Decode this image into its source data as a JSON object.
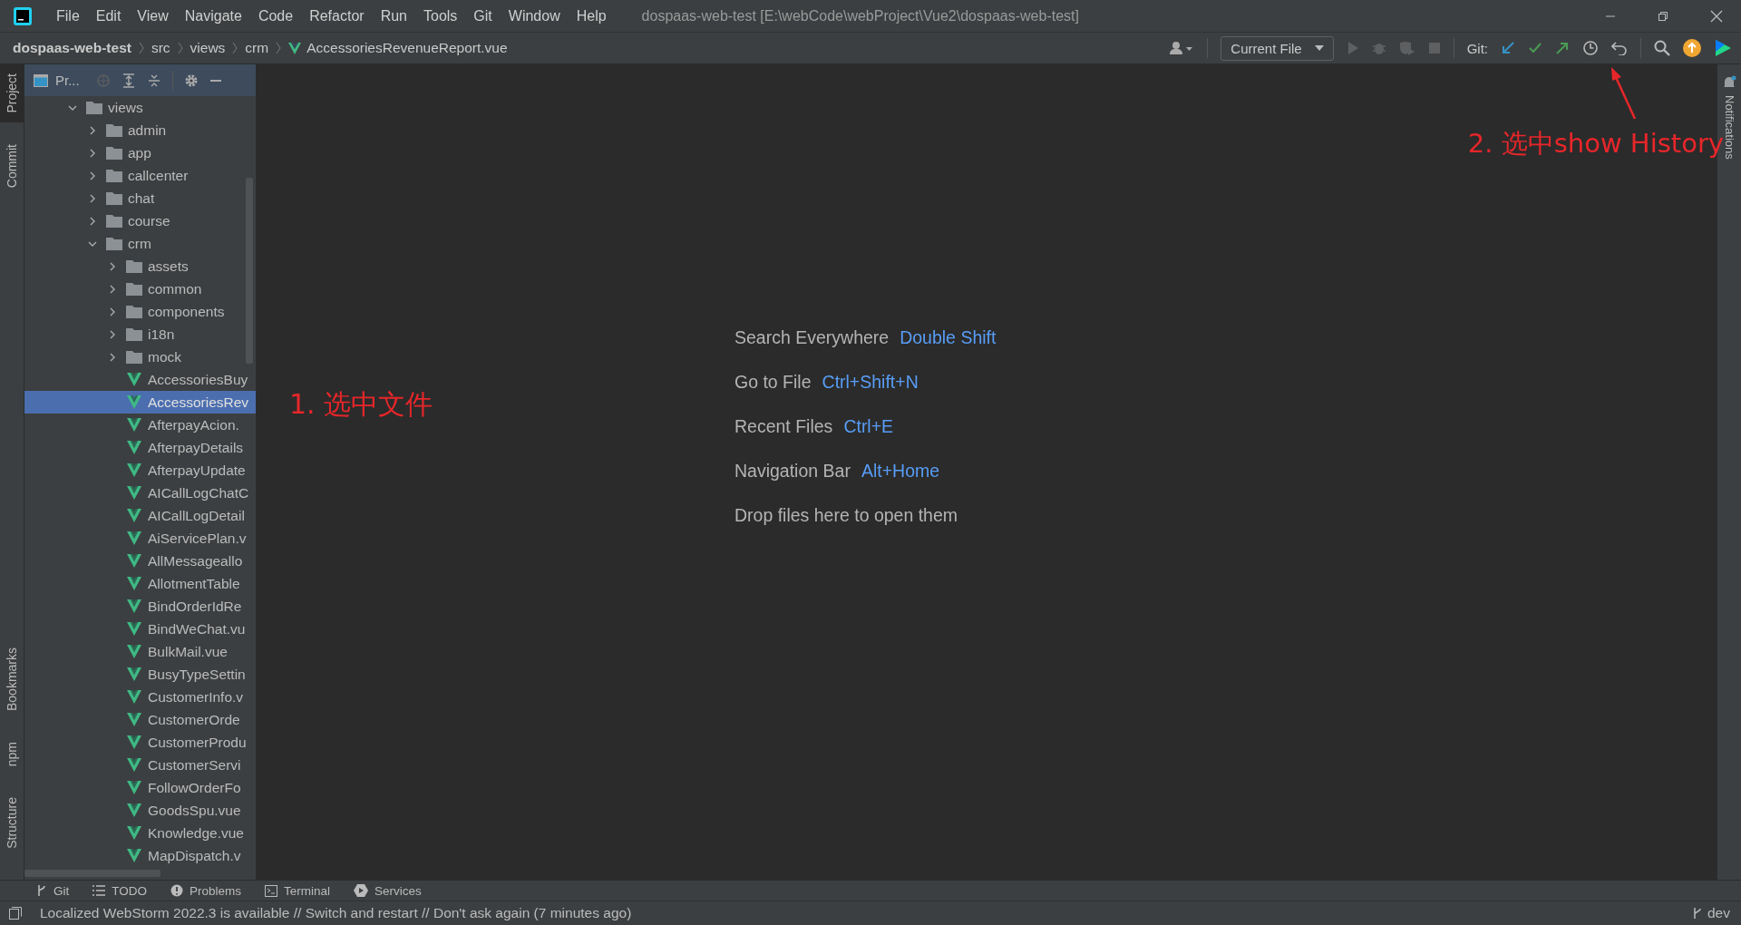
{
  "menu": [
    "File",
    "Edit",
    "View",
    "Navigate",
    "Code",
    "Refactor",
    "Run",
    "Tools",
    "Git",
    "Window",
    "Help"
  ],
  "window": {
    "title": "dospaas-web-test [E:\\webCode\\webProject\\Vue2\\dospaas-web-test]"
  },
  "breadcrumb": [
    "dospaas-web-test",
    "src",
    "views",
    "crm"
  ],
  "breadcrumb_file": "AccessoriesRevenueReport.vue",
  "toolbar": {
    "run_config": "Current File",
    "git_label": "Git:"
  },
  "left_stripe_top": [
    {
      "label": "Project",
      "selected": true
    },
    {
      "label": "Commit",
      "selected": false
    }
  ],
  "left_stripe_bottom": [
    {
      "label": "Bookmarks",
      "selected": false
    },
    {
      "label": "npm",
      "selected": false
    },
    {
      "label": "Structure",
      "selected": false
    }
  ],
  "project_panel": {
    "title": "Pr..."
  },
  "tree": [
    {
      "label": "views",
      "kind": "folder",
      "expanded": true,
      "selected": false,
      "children": [
        {
          "label": "admin",
          "kind": "folder",
          "expanded": false,
          "selected": false
        },
        {
          "label": "app",
          "kind": "folder",
          "expanded": false,
          "selected": false
        },
        {
          "label": "callcenter",
          "kind": "folder",
          "expanded": false,
          "selected": false
        },
        {
          "label": "chat",
          "kind": "folder",
          "expanded": false,
          "selected": false
        },
        {
          "label": "course",
          "kind": "folder",
          "expanded": false,
          "selected": false
        },
        {
          "label": "crm",
          "kind": "folder",
          "expanded": true,
          "selected": false,
          "children": [
            {
              "label": "assets",
              "kind": "folder",
              "expanded": false,
              "selected": false
            },
            {
              "label": "common",
              "kind": "folder",
              "expanded": false,
              "selected": false
            },
            {
              "label": "components",
              "kind": "folder",
              "expanded": false,
              "selected": false
            },
            {
              "label": "i18n",
              "kind": "folder",
              "expanded": false,
              "selected": false
            },
            {
              "label": "mock",
              "kind": "folder",
              "expanded": false,
              "selected": false
            },
            {
              "label": "AccessoriesBuy",
              "kind": "file",
              "selected": false
            },
            {
              "label": "AccessoriesRev",
              "kind": "file",
              "selected": true
            },
            {
              "label": "AfterpayAcion.",
              "kind": "file",
              "selected": false
            },
            {
              "label": "AfterpayDetails",
              "kind": "file",
              "selected": false
            },
            {
              "label": "AfterpayUpdate",
              "kind": "file",
              "selected": false
            },
            {
              "label": "AICallLogChatC",
              "kind": "file",
              "selected": false
            },
            {
              "label": "AICallLogDetail",
              "kind": "file",
              "selected": false
            },
            {
              "label": "AiServicePlan.v",
              "kind": "file",
              "selected": false
            },
            {
              "label": "AllMessageallo",
              "kind": "file",
              "selected": false
            },
            {
              "label": "AllotmentTable",
              "kind": "file",
              "selected": false
            },
            {
              "label": "BindOrderIdRe",
              "kind": "file",
              "selected": false
            },
            {
              "label": "BindWeChat.vu",
              "kind": "file",
              "selected": false
            },
            {
              "label": "BulkMail.vue",
              "kind": "file",
              "selected": false
            },
            {
              "label": "BusyTypeSettin",
              "kind": "file",
              "selected": false
            },
            {
              "label": "CustomerInfo.v",
              "kind": "file",
              "selected": false
            },
            {
              "label": "CustomerOrde",
              "kind": "file",
              "selected": false
            },
            {
              "label": "CustomerProdu",
              "kind": "file",
              "selected": false
            },
            {
              "label": "CustomerServi",
              "kind": "file",
              "selected": false
            },
            {
              "label": "FollowOrderFo",
              "kind": "file",
              "selected": false
            },
            {
              "label": "GoodsSpu.vue",
              "kind": "file",
              "selected": false
            },
            {
              "label": "Knowledge.vue",
              "kind": "file",
              "selected": false
            },
            {
              "label": "MapDispatch.v",
              "kind": "file",
              "selected": false
            }
          ]
        }
      ]
    }
  ],
  "editor_hints": [
    {
      "label": "Search Everywhere",
      "shortcut": "Double Shift"
    },
    {
      "label": "Go to File",
      "shortcut": "Ctrl+Shift+N"
    },
    {
      "label": "Recent Files",
      "shortcut": "Ctrl+E"
    },
    {
      "label": "Navigation Bar",
      "shortcut": "Alt+Home"
    },
    {
      "label": "Drop files here to open them"
    }
  ],
  "annotations": [
    "1. 选中文件",
    "2. 选中show History"
  ],
  "right_stripe": "Notifications",
  "bottom_tools": [
    {
      "label": "Git",
      "kind": "git"
    },
    {
      "label": "TODO",
      "kind": "todo"
    },
    {
      "label": "Problems",
      "kind": "problems"
    },
    {
      "label": "Terminal",
      "kind": "terminal"
    },
    {
      "label": "Services",
      "kind": "services"
    }
  ],
  "status_bar": {
    "message": "Localized WebStorm 2022.3 is available // Switch and restart // Don't ask again (7 minutes ago)",
    "branch": "dev"
  }
}
